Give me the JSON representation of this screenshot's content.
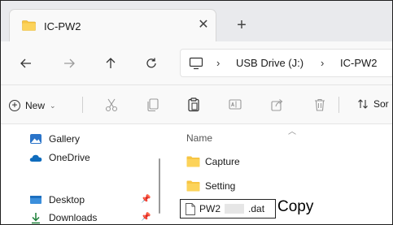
{
  "window": {
    "tab_title": "IC-PW2",
    "tab_close": "✕",
    "new_tab": "+"
  },
  "nav": {
    "back": "back",
    "forward": "forward",
    "up": "up",
    "refresh": "refresh"
  },
  "address": {
    "crumbs": [
      "USB Drive (J:)",
      "IC-PW2"
    ],
    "separator": "›"
  },
  "toolbar": {
    "new_label": "New",
    "sort_label": "Sor"
  },
  "sidebar": {
    "items": [
      {
        "label": "Gallery",
        "icon": "gallery-icon",
        "pinned": false
      },
      {
        "label": "OneDrive",
        "icon": "onedrive-icon",
        "pinned": false
      },
      {
        "label": "Desktop",
        "icon": "desktop-icon",
        "pinned": true
      },
      {
        "label": "Downloads",
        "icon": "downloads-icon",
        "pinned": true
      }
    ]
  },
  "content": {
    "column_name": "Name",
    "folders": [
      "Capture",
      "Setting"
    ],
    "file": {
      "prefix": "PW2",
      "suffix": ".dat"
    },
    "annotation": "Copy"
  },
  "colors": {
    "folder": "#f7c543",
    "onedrive": "#0f6cbd",
    "gallery": "#2a74c9",
    "accent": "#0067c0"
  }
}
